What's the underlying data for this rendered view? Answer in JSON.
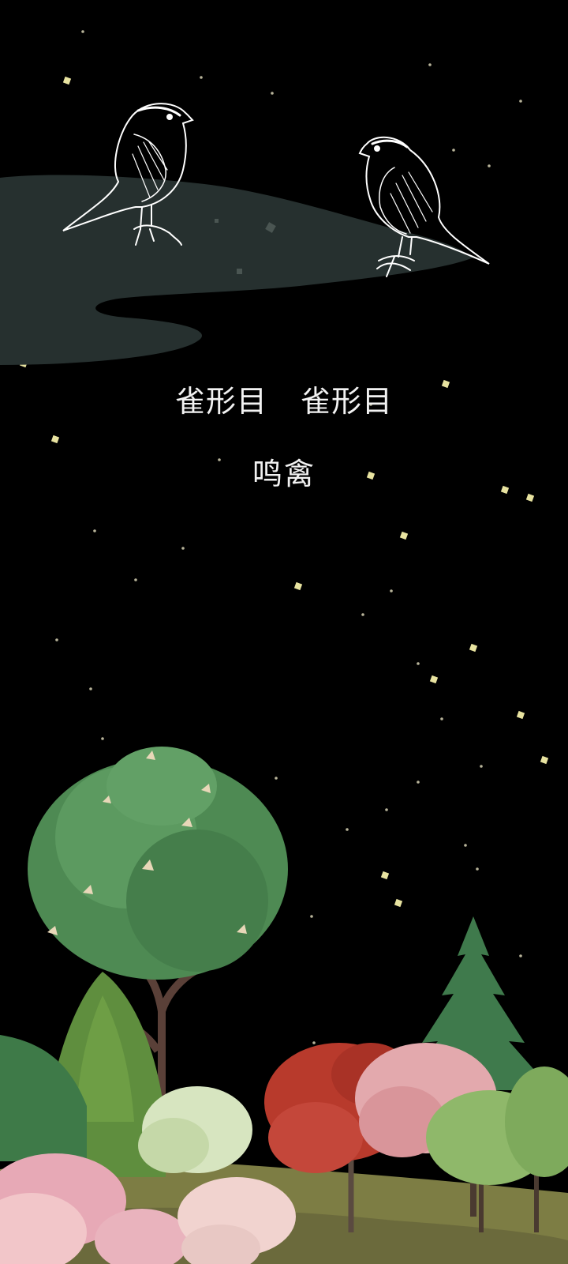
{
  "labels": {
    "order_left": "雀形目",
    "order_right": "雀形目",
    "category": "鸣禽"
  },
  "scene": {
    "birds": [
      {
        "name": "sparrow-left-icon",
        "facing": "right"
      },
      {
        "name": "sparrow-right-icon",
        "facing": "left"
      }
    ],
    "colors": {
      "background": "#000000",
      "cloud": "#26302f",
      "star": "#e8e3a0",
      "tree_green": "#4e8a53",
      "tree_pine": "#3f7a4c",
      "tree_red": "#b83a2c",
      "tree_pink": "#e3a9ad",
      "ground": "#8a8a4a",
      "bird_line": "#ffffff"
    }
  }
}
